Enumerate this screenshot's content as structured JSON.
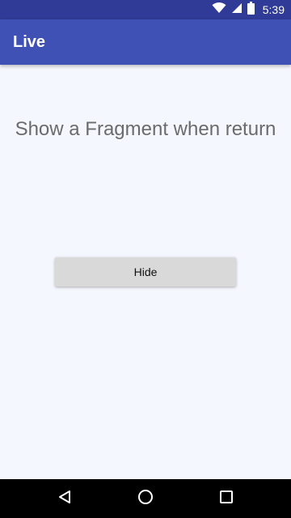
{
  "status_bar": {
    "time": "5:39",
    "icons": [
      "wifi-icon",
      "signal-icon",
      "battery-icon"
    ]
  },
  "app_bar": {
    "title": "Live",
    "color": "#3f51b5",
    "status_color": "#2f3b96"
  },
  "main": {
    "message": "Show a Fragment when return",
    "button_label": "Hide"
  },
  "nav_bar": {
    "icons": [
      "back-icon",
      "home-icon",
      "recents-icon"
    ]
  }
}
